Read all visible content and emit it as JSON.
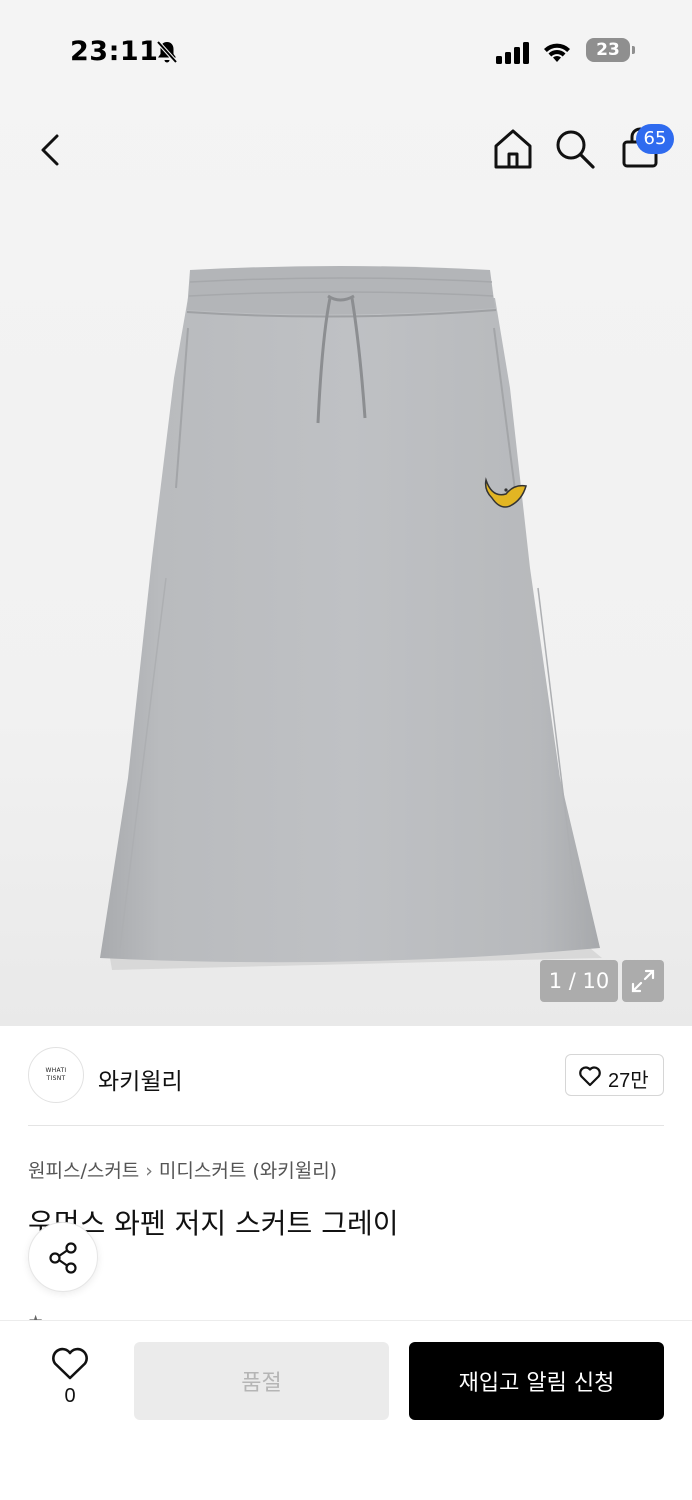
{
  "status_bar": {
    "time": "23:11",
    "battery": "23"
  },
  "header": {
    "cart_count": "65"
  },
  "gallery": {
    "counter": "1 / 10"
  },
  "brand": {
    "logo_text_line1": "WHATI",
    "logo_text_line2": "TISNT",
    "name": "와키윌리",
    "likes": "27만"
  },
  "breadcrumb": {
    "category": "원피스/스커트",
    "subcategory": "미디스커트 (와키윌리)"
  },
  "product": {
    "title": "우먼스 와펜 저지 스커트 그레이"
  },
  "bottom_bar": {
    "wish_count": "0",
    "soldout_label": "품절",
    "restock_label": "재입고 알림 신청"
  },
  "colors": {
    "accent_badge": "#2f6bef",
    "primary_button": "#000000",
    "disabled_button": "#ebebeb"
  }
}
